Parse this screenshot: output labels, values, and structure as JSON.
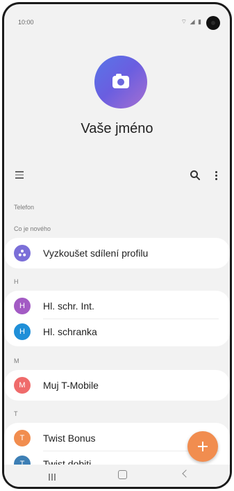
{
  "status_bar": {
    "time": "10:00",
    "icons_text": "⌔ ◢ ▮"
  },
  "profile": {
    "name": "Vaše jméno"
  },
  "section_label": "Telefon",
  "whats_new": {
    "label": "Co je nového",
    "item": {
      "avatar_letter": "",
      "name": "Vyzkoušet sdílení profilu",
      "color": "#7b6fd8"
    }
  },
  "groups": [
    {
      "letter": "H",
      "contacts": [
        {
          "initial": "H",
          "name": "Hl. schr. Int.",
          "color": "#a35bc4"
        },
        {
          "initial": "H",
          "name": "Hl. schranka",
          "color": "#1f8fd8"
        }
      ]
    },
    {
      "letter": "M",
      "contacts": [
        {
          "initial": "M",
          "name": "Muj T-Mobile",
          "color": "#ef6b6b"
        }
      ]
    },
    {
      "letter": "T",
      "contacts": [
        {
          "initial": "T",
          "name": "Twist Bonus",
          "color": "#f18d4f"
        },
        {
          "initial": "T",
          "name": "Twist dobiti",
          "color": "#3d7fb5"
        }
      ]
    }
  ]
}
